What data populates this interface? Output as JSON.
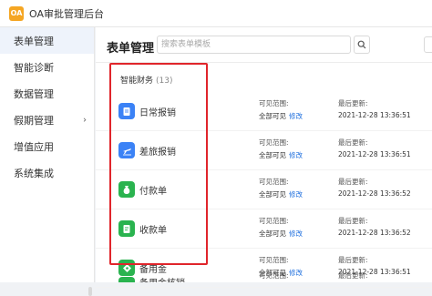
{
  "app": {
    "logo_text": "OA",
    "title": "OA审批管理后台"
  },
  "sidebar": {
    "items": [
      {
        "label": "表单管理",
        "active": true
      },
      {
        "label": "智能诊断"
      },
      {
        "label": "数据管理"
      },
      {
        "label": "假期管理",
        "has_arrow": true,
        "arrow": "›"
      },
      {
        "label": "增值应用"
      },
      {
        "label": "系统集成"
      }
    ]
  },
  "main": {
    "title": "表单管理",
    "search_placeholder": "搜索表单模板",
    "group": {
      "name": "智能财务",
      "count": "(13)"
    },
    "visibility_label": "可见范围:",
    "updated_label": "最后更新:",
    "edit_label": "修改",
    "rows": [
      {
        "name": "日常报销",
        "icon": "document-icon",
        "color": "#3b82f6",
        "visibility": "全部可见",
        "updated": "2021-12-28 13:36:51"
      },
      {
        "name": "差旅报销",
        "icon": "airplane-icon",
        "color": "#3b82f6",
        "visibility": "全部可见",
        "updated": "2021-12-28 13:36:51"
      },
      {
        "name": "付款单",
        "icon": "money-bag-icon",
        "color": "#2ab34f",
        "visibility": "全部可见",
        "updated": "2021-12-28 13:36:52"
      },
      {
        "name": "收款单",
        "icon": "receipt-icon",
        "color": "#2ab34f",
        "visibility": "全部可见",
        "updated": "2021-12-28 13:36:52"
      },
      {
        "name": "备用金",
        "icon": "tag-icon",
        "color": "#2ab34f",
        "visibility": "全部可见",
        "updated": "2021-12-28 13:36:51"
      },
      {
        "name": "备用金核销",
        "icon": "tag-icon",
        "color": "#2ab34f",
        "visibility": "",
        "updated": ""
      }
    ]
  }
}
